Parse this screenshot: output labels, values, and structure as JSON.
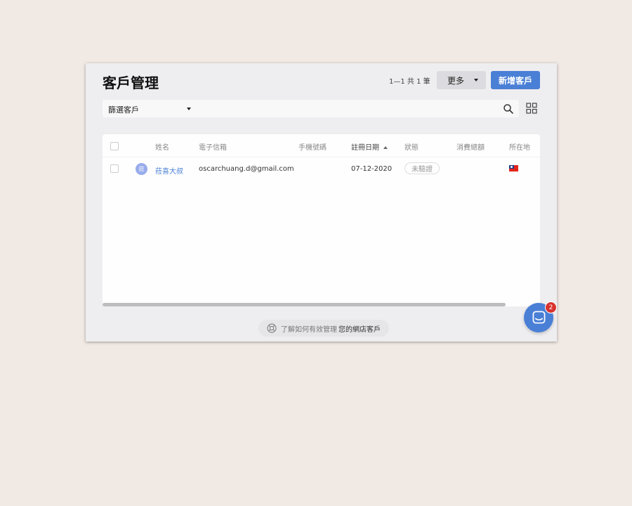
{
  "header": {
    "title": "客戶管理",
    "pagination": "1—1 共 1 筆",
    "more_label": "更多",
    "add_label": "新增客戶"
  },
  "filter": {
    "select_label": "篩選客戶",
    "search_icon": "search-icon",
    "view_icon": "grid-view-icon"
  },
  "table": {
    "columns": [
      "姓名",
      "電子信箱",
      "手機號碼",
      "註冊日期",
      "狀態",
      "消費總額",
      "所在地"
    ],
    "sorted_column": "註冊日期",
    "rows": [
      {
        "avatar": "菈",
        "name": "菈喜大叔",
        "email": "oscarchuang.d@gmail.com",
        "phone": "",
        "registered": "07-12-2020",
        "status": "未驗證",
        "total": "",
        "location_flag": "taiwan-flag"
      }
    ]
  },
  "help": {
    "prefix": "了解如何有效管理",
    "link": "您的網店客戶"
  },
  "chat": {
    "badge_count": "2"
  },
  "colors": {
    "accent": "#4a7fd6",
    "badge": "#d9332e",
    "background": "#f1e9e4"
  }
}
